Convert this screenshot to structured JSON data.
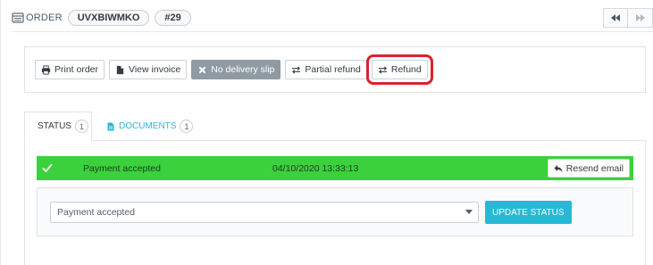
{
  "header": {
    "title": "ORDER",
    "reference": "UVXBIWMKO",
    "order_id": "#29"
  },
  "actions": {
    "print_order": "Print order",
    "view_invoice": "View invoice",
    "no_delivery_slip": "No delivery slip",
    "partial_refund": "Partial refund",
    "refund": "Refund"
  },
  "tabs": [
    {
      "label": "STATUS",
      "count": "1",
      "active": true
    },
    {
      "label": "DOCUMENTS",
      "count": "1",
      "active": false
    }
  ],
  "status_history": {
    "status": "Payment accepted",
    "date": "04/10/2020 13:33:13",
    "resend_label": "Resend email",
    "row_color": "#3bd13d"
  },
  "status_form": {
    "selected": "Payment accepted",
    "update_label": "UPDATE STATUS"
  },
  "colors": {
    "accent": "#25b9d7",
    "highlight": "#d9232e"
  },
  "icons": {
    "header": "order-list-icon",
    "print": "printer-icon",
    "invoice": "file-icon",
    "no_delivery": "x-icon",
    "partial_refund": "exchange-icon",
    "refund": "exchange-icon",
    "status_tab": "clock-icon",
    "documents_tab": "file-icon",
    "status_check": "check-icon",
    "resend": "reply-icon",
    "nav_prev": "double-left-icon",
    "nav_next": "double-right-icon"
  }
}
